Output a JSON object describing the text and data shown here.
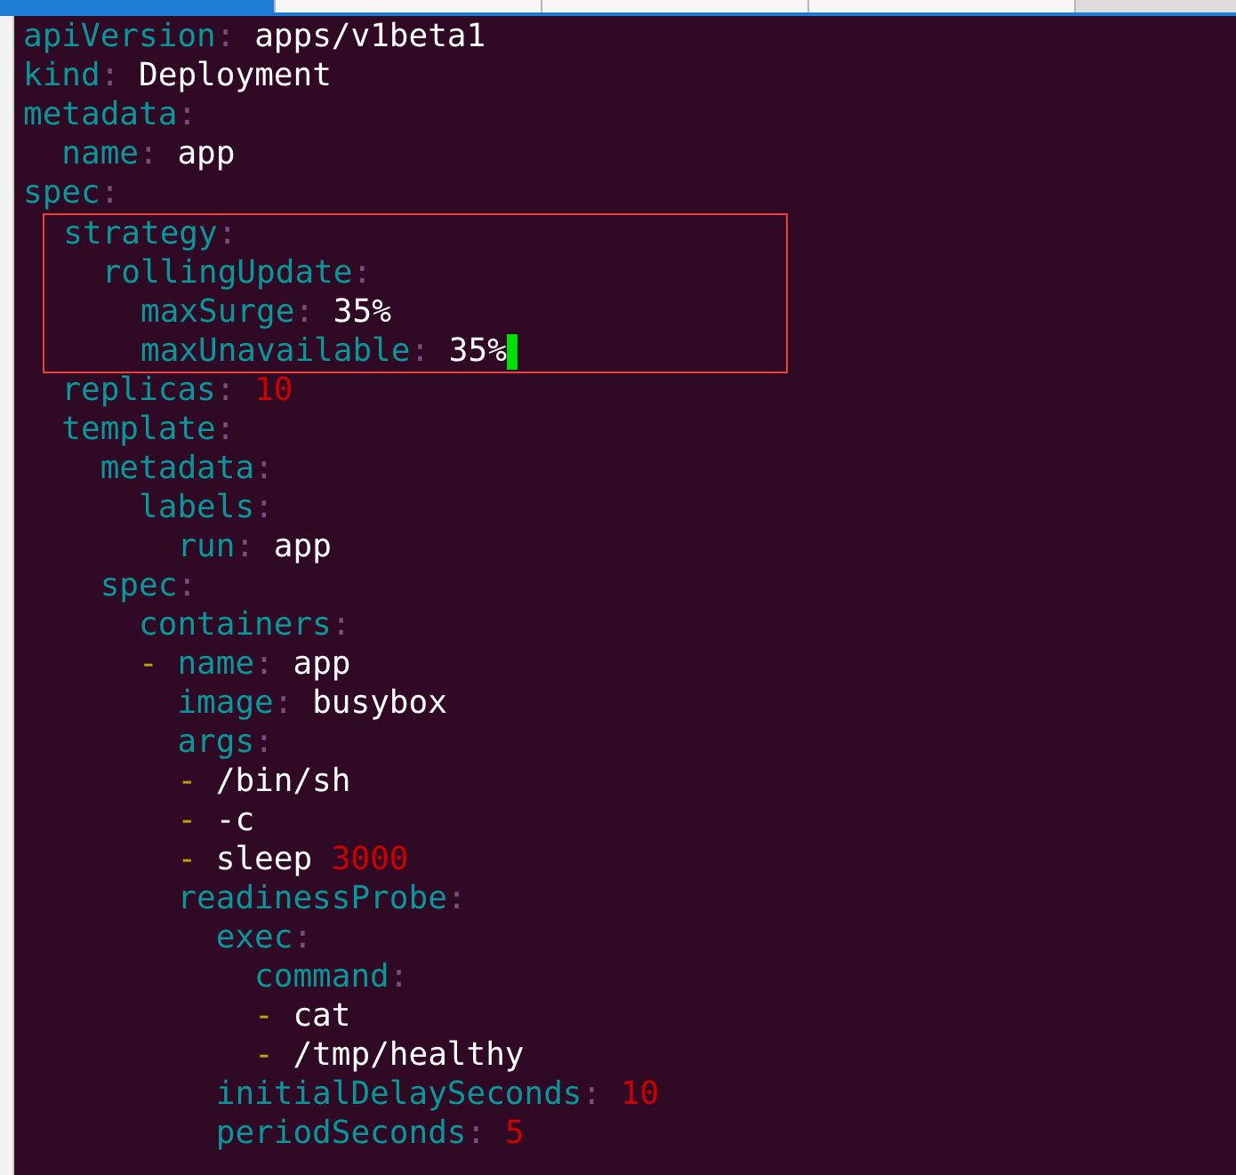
{
  "tab_strip": {
    "tabs": [
      {
        "selected": true
      },
      {
        "selected": false
      },
      {
        "selected": false
      },
      {
        "selected": false
      }
    ]
  },
  "document": [
    {
      "kind": "map",
      "key": "apiVersion",
      "colon": ":",
      "value": {
        "text": "apps/v1beta1",
        "color": "#ffffff"
      }
    },
    {
      "kind": "map",
      "key": "kind",
      "colon": ":",
      "value": {
        "text": "Deployment",
        "color": "#ffffff"
      }
    },
    {
      "kind": "map",
      "key": "metadata",
      "colon": ":",
      "children": [
        {
          "kind": "map",
          "key": "name",
          "colon": ":",
          "value": {
            "text": "app",
            "color": "#ffffff"
          }
        }
      ]
    },
    {
      "kind": "map",
      "key": "spec",
      "colon": ":",
      "children": [
        {
          "kind": "map",
          "key": "strategy",
          "colon": ":",
          "highlighted": true,
          "children": [
            {
              "kind": "map",
              "key": "rollingUpdate",
              "colon": ":",
              "children": [
                {
                  "kind": "map",
                  "key": "maxSurge",
                  "colon": ":",
                  "value": {
                    "text": "35%",
                    "color": "#ffffff"
                  }
                },
                {
                  "kind": "map",
                  "key": "maxUnavailable",
                  "colon": ":",
                  "value": {
                    "text": "35%",
                    "color": "#ffffff"
                  },
                  "cursor": true
                }
              ]
            }
          ]
        },
        {
          "kind": "map",
          "key": "replicas",
          "colon": ":",
          "value": {
            "text": "10",
            "color": "#cc0000"
          }
        },
        {
          "kind": "map",
          "key": "template",
          "colon": ":",
          "children": [
            {
              "kind": "map",
              "key": "metadata",
              "colon": ":",
              "children": [
                {
                  "kind": "map",
                  "key": "labels",
                  "colon": ":",
                  "children": [
                    {
                      "kind": "map",
                      "key": "run",
                      "colon": ":",
                      "value": {
                        "text": "app",
                        "color": "#ffffff"
                      }
                    }
                  ]
                }
              ]
            },
            {
              "kind": "map",
              "key": "spec",
              "colon": ":",
              "children": [
                {
                  "kind": "map",
                  "key": "containers",
                  "colon": ":",
                  "children": [
                    {
                      "kind": "seq",
                      "dash": "-",
                      "entries": [
                        {
                          "kind": "map",
                          "key": "name",
                          "colon": ":",
                          "value": {
                            "text": "app",
                            "color": "#ffffff"
                          }
                        },
                        {
                          "kind": "map",
                          "key": "image",
                          "colon": ":",
                          "value": {
                            "text": "busybox",
                            "color": "#ffffff"
                          }
                        },
                        {
                          "kind": "map",
                          "key": "args",
                          "colon": ":",
                          "children": [
                            {
                              "kind": "seq",
                              "dash": "-",
                              "value": {
                                "text": "/bin/sh",
                                "color": "#ffffff"
                              }
                            },
                            {
                              "kind": "seq",
                              "dash": "-",
                              "value": {
                                "text": "-c",
                                "color": "#ffffff"
                              }
                            },
                            {
                              "kind": "seq",
                              "dash": "-",
                              "value": {
                                "text": "sleep",
                                "color": "#ffffff"
                              },
                              "suffix": {
                                "text": "3000",
                                "color": "#cc0000"
                              }
                            }
                          ]
                        },
                        {
                          "kind": "map",
                          "key": "readinessProbe",
                          "colon": ":",
                          "children": [
                            {
                              "kind": "map",
                              "key": "exec",
                              "colon": ":",
                              "children": [
                                {
                                  "kind": "map",
                                  "key": "command",
                                  "colon": ":",
                                  "children": [
                                    {
                                      "kind": "seq",
                                      "dash": "-",
                                      "value": {
                                        "text": "cat",
                                        "color": "#ffffff"
                                      }
                                    },
                                    {
                                      "kind": "seq",
                                      "dash": "-",
                                      "value": {
                                        "text": "/tmp/healthy",
                                        "color": "#ffffff"
                                      }
                                    }
                                  ]
                                }
                              ]
                            },
                            {
                              "kind": "map",
                              "key": "initialDelaySeconds",
                              "colon": ":",
                              "value": {
                                "text": "10",
                                "color": "#cc0000"
                              }
                            },
                            {
                              "kind": "map",
                              "key": "periodSeconds",
                              "colon": ":",
                              "value": {
                                "text": "5",
                                "color": "#cc0000"
                              }
                            }
                          ]
                        }
                      ]
                    }
                  ]
                }
              ]
            }
          ]
        }
      ]
    }
  ]
}
